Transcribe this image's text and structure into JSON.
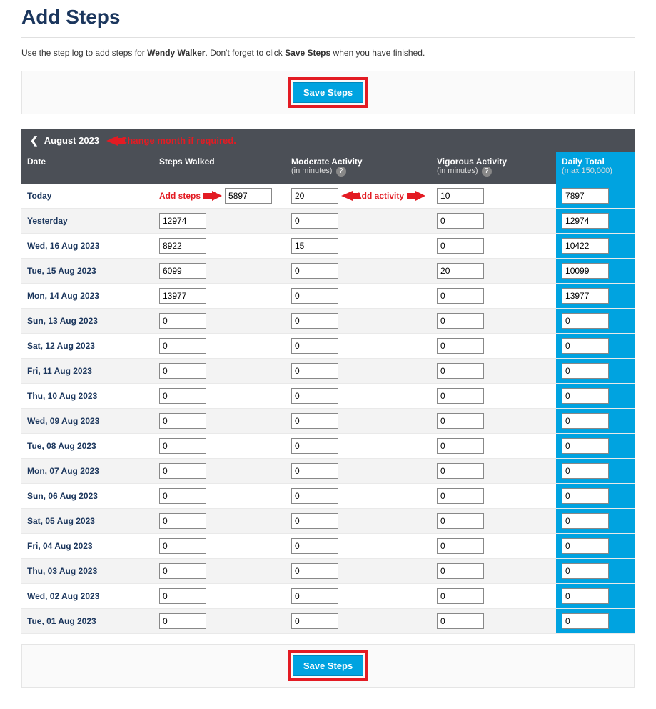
{
  "page": {
    "title": "Add Steps",
    "intro_prefix": "Use the step log to add steps for ",
    "user_name": "Wendy Walker",
    "intro_mid": ". Don't forget to click ",
    "intro_action": "Save Steps",
    "intro_suffix": " when you have finished.",
    "save_button": "Save Steps"
  },
  "month_nav": {
    "month_label": "August 2023",
    "annotation": "Change month if required."
  },
  "annotations": {
    "add_steps": "Add steps",
    "add_activity": "Add activity"
  },
  "headers": {
    "date": "Date",
    "steps": "Steps Walked",
    "moderate": "Moderate Activity",
    "moderate_sub": "(in minutes)",
    "vigorous": "Vigorous Activity",
    "vigorous_sub": "(in minutes)",
    "total": "Daily Total",
    "total_sub": "(max 150,000)",
    "help": "?"
  },
  "rows": [
    {
      "date": "Today",
      "steps": "5897",
      "moderate": "20",
      "vigorous": "10",
      "total": "7897",
      "annotated": true
    },
    {
      "date": "Yesterday",
      "steps": "12974",
      "moderate": "0",
      "vigorous": "0",
      "total": "12974"
    },
    {
      "date": "Wed, 16 Aug 2023",
      "steps": "8922",
      "moderate": "15",
      "vigorous": "0",
      "total": "10422"
    },
    {
      "date": "Tue, 15 Aug 2023",
      "steps": "6099",
      "moderate": "0",
      "vigorous": "20",
      "total": "10099"
    },
    {
      "date": "Mon, 14 Aug 2023",
      "steps": "13977",
      "moderate": "0",
      "vigorous": "0",
      "total": "13977"
    },
    {
      "date": "Sun, 13 Aug 2023",
      "steps": "0",
      "moderate": "0",
      "vigorous": "0",
      "total": "0"
    },
    {
      "date": "Sat, 12 Aug 2023",
      "steps": "0",
      "moderate": "0",
      "vigorous": "0",
      "total": "0"
    },
    {
      "date": "Fri, 11 Aug 2023",
      "steps": "0",
      "moderate": "0",
      "vigorous": "0",
      "total": "0"
    },
    {
      "date": "Thu, 10 Aug 2023",
      "steps": "0",
      "moderate": "0",
      "vigorous": "0",
      "total": "0"
    },
    {
      "date": "Wed, 09 Aug 2023",
      "steps": "0",
      "moderate": "0",
      "vigorous": "0",
      "total": "0"
    },
    {
      "date": "Tue, 08 Aug 2023",
      "steps": "0",
      "moderate": "0",
      "vigorous": "0",
      "total": "0"
    },
    {
      "date": "Mon, 07 Aug 2023",
      "steps": "0",
      "moderate": "0",
      "vigorous": "0",
      "total": "0"
    },
    {
      "date": "Sun, 06 Aug 2023",
      "steps": "0",
      "moderate": "0",
      "vigorous": "0",
      "total": "0"
    },
    {
      "date": "Sat, 05 Aug 2023",
      "steps": "0",
      "moderate": "0",
      "vigorous": "0",
      "total": "0"
    },
    {
      "date": "Fri, 04 Aug 2023",
      "steps": "0",
      "moderate": "0",
      "vigorous": "0",
      "total": "0"
    },
    {
      "date": "Thu, 03 Aug 2023",
      "steps": "0",
      "moderate": "0",
      "vigorous": "0",
      "total": "0"
    },
    {
      "date": "Wed, 02 Aug 2023",
      "steps": "0",
      "moderate": "0",
      "vigorous": "0",
      "total": "0"
    },
    {
      "date": "Tue, 01 Aug 2023",
      "steps": "0",
      "moderate": "0",
      "vigorous": "0",
      "total": "0"
    }
  ]
}
